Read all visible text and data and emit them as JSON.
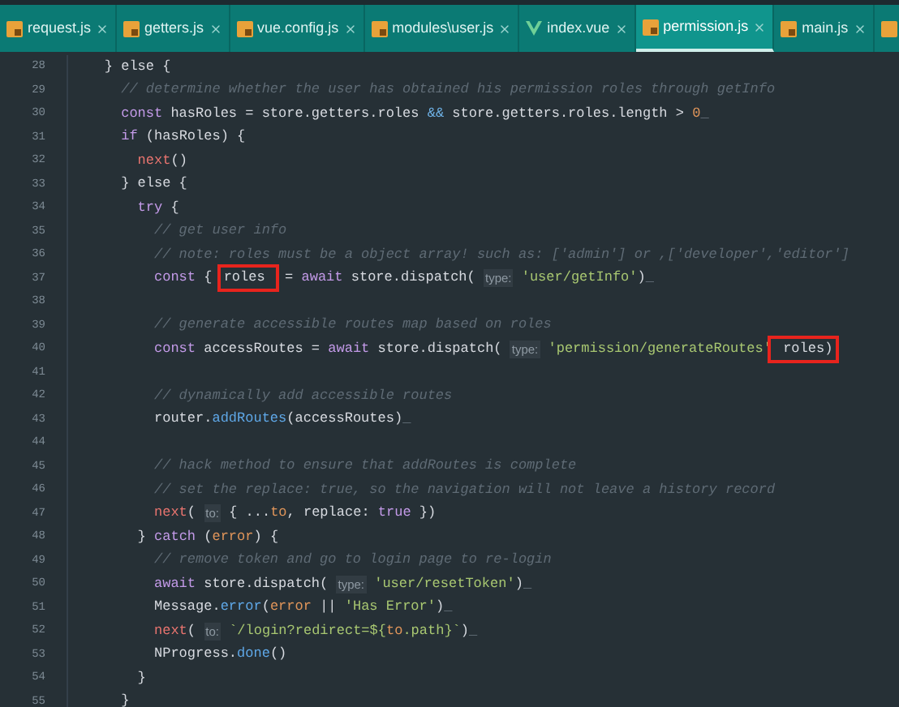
{
  "tabs": [
    {
      "label": "request.js",
      "kind": "js",
      "selected": false
    },
    {
      "label": "getters.js",
      "kind": "js",
      "selected": false
    },
    {
      "label": "vue.config.js",
      "kind": "js",
      "selected": false
    },
    {
      "label": "modules\\user.js",
      "kind": "js",
      "selected": false
    },
    {
      "label": "index.vue",
      "kind": "vue",
      "selected": false
    },
    {
      "label": "permission.js",
      "kind": "js",
      "selected": true
    },
    {
      "label": "main.js",
      "kind": "js",
      "selected": false
    }
  ],
  "lines": [
    {
      "number": "28",
      "tokens": [
        {
          "text": "    } else {",
          "kind": "plain"
        }
      ]
    },
    {
      "number": "29",
      "tokens": [
        {
          "text": "      // determine whether the user has obtained his permission roles through getInfo",
          "kind": "comment"
        }
      ]
    },
    {
      "number": "30",
      "tokens": [
        {
          "text": "      const",
          "kind": "kw"
        },
        {
          "text": " hasRoles = store.getters.roles ",
          "kind": "plain"
        },
        {
          "text": "&&",
          "kind": "op"
        },
        {
          "text": " store.getters.roles.length > ",
          "kind": "plain"
        },
        {
          "text": "0",
          "kind": "num"
        },
        {
          "text": "_",
          "kind": "mark"
        }
      ]
    },
    {
      "number": "31",
      "tokens": [
        {
          "text": "      if",
          "kind": "kw"
        },
        {
          "text": " (hasRoles) {",
          "kind": "plain"
        }
      ]
    },
    {
      "number": "32",
      "tokens": [
        {
          "text": "        next",
          "kind": "call"
        },
        {
          "text": "()",
          "kind": "plain"
        }
      ]
    },
    {
      "number": "33",
      "tokens": [
        {
          "text": "      } else {",
          "kind": "plain"
        }
      ]
    },
    {
      "number": "34",
      "tokens": [
        {
          "text": "        try",
          "kind": "kw"
        },
        {
          "text": " {",
          "kind": "plain"
        }
      ]
    },
    {
      "number": "35",
      "tokens": [
        {
          "text": "          // get user info",
          "kind": "comment"
        }
      ]
    },
    {
      "number": "36",
      "tokens": [
        {
          "text": "          // note: roles must be a object array! such as: ['admin'] or ,['developer','editor']",
          "kind": "comment"
        }
      ]
    },
    {
      "number": "37",
      "tokens": [
        {
          "text": "          const",
          "kind": "kw"
        },
        {
          "text": " { ",
          "kind": "plain"
        },
        {
          "text": "roles ",
          "kind": "boxed"
        },
        {
          "text": " = ",
          "kind": "plain"
        },
        {
          "text": "await",
          "kind": "kw"
        },
        {
          "text": " store.dispatch( ",
          "kind": "plain"
        },
        {
          "text": "type:",
          "kind": "hint"
        },
        {
          "text": " 'user/getInfo'",
          "kind": "str"
        },
        {
          "text": ")",
          "kind": "plain"
        },
        {
          "text": "_",
          "kind": "mark"
        }
      ]
    },
    {
      "number": "38"
    },
    {
      "number": "39",
      "tokens": [
        {
          "text": "          // generate accessible routes map based on roles",
          "kind": "comment"
        }
      ]
    },
    {
      "number": "40",
      "tokens": [
        {
          "text": "          const",
          "kind": "kw"
        },
        {
          "text": " accessRoutes = ",
          "kind": "plain"
        },
        {
          "text": "await",
          "kind": "kw"
        },
        {
          "text": " store.dispatch( ",
          "kind": "plain"
        },
        {
          "text": "type:",
          "kind": "hint"
        },
        {
          "text": " 'permission/generateRoutes'",
          "kind": "str"
        },
        {
          "text": " roles)",
          "kind": "boxed"
        }
      ]
    },
    {
      "number": "41"
    },
    {
      "number": "42",
      "tokens": [
        {
          "text": "          // dynamically add accessible routes",
          "kind": "comment"
        }
      ]
    },
    {
      "number": "43",
      "tokens": [
        {
          "text": "          router.",
          "kind": "plain"
        },
        {
          "text": "addRoutes",
          "kind": "method"
        },
        {
          "text": "(accessRoutes)",
          "kind": "plain"
        },
        {
          "text": "_",
          "kind": "mark"
        }
      ]
    },
    {
      "number": "44"
    },
    {
      "number": "45",
      "tokens": [
        {
          "text": "          // hack method to ensure that addRoutes is complete",
          "kind": "comment"
        }
      ]
    },
    {
      "number": "46",
      "tokens": [
        {
          "text": "          // set the replace: true, so the navigation will not leave a history record",
          "kind": "comment"
        }
      ]
    },
    {
      "number": "47",
      "tokens": [
        {
          "text": "          next",
          "kind": "call"
        },
        {
          "text": "( ",
          "kind": "plain"
        },
        {
          "text": "to:",
          "kind": "hint"
        },
        {
          "text": " { ...",
          "kind": "plain"
        },
        {
          "text": "to",
          "kind": "param"
        },
        {
          "text": ", replace: ",
          "kind": "plain"
        },
        {
          "text": "true",
          "kind": "kw"
        },
        {
          "text": " })",
          "kind": "plain"
        }
      ]
    },
    {
      "number": "48",
      "tokens": [
        {
          "text": "        } ",
          "kind": "plain"
        },
        {
          "text": "catch",
          "kind": "kw"
        },
        {
          "text": " (",
          "kind": "plain"
        },
        {
          "text": "error",
          "kind": "param"
        },
        {
          "text": ") {",
          "kind": "plain"
        }
      ]
    },
    {
      "number": "49",
      "tokens": [
        {
          "text": "          // remove token and go to login page to re-login",
          "kind": "comment"
        }
      ]
    },
    {
      "number": "50",
      "tokens": [
        {
          "text": "          await",
          "kind": "kw"
        },
        {
          "text": " store.dispatch( ",
          "kind": "plain"
        },
        {
          "text": "type:",
          "kind": "hint"
        },
        {
          "text": " 'user/resetToken'",
          "kind": "str"
        },
        {
          "text": ")",
          "kind": "plain"
        },
        {
          "text": "_",
          "kind": "mark"
        }
      ]
    },
    {
      "number": "51",
      "tokens": [
        {
          "text": "          Message.",
          "kind": "plain"
        },
        {
          "text": "error",
          "kind": "method"
        },
        {
          "text": "(",
          "kind": "plain"
        },
        {
          "text": "error",
          "kind": "param"
        },
        {
          "text": " || ",
          "kind": "plain"
        },
        {
          "text": "'Has Error'",
          "kind": "str"
        },
        {
          "text": ")",
          "kind": "plain"
        },
        {
          "text": "_",
          "kind": "mark"
        }
      ]
    },
    {
      "number": "52",
      "tokens": [
        {
          "text": "          next",
          "kind": "call"
        },
        {
          "text": "( ",
          "kind": "plain"
        },
        {
          "text": "to:",
          "kind": "hint"
        },
        {
          "text": " `/login?redirect=${",
          "kind": "str"
        },
        {
          "text": "to",
          "kind": "param"
        },
        {
          "text": ".path}`",
          "kind": "str"
        },
        {
          "text": ")",
          "kind": "plain"
        },
        {
          "text": "_",
          "kind": "mark"
        }
      ]
    },
    {
      "number": "53",
      "tokens": [
        {
          "text": "          NProgress.",
          "kind": "plain"
        },
        {
          "text": "done",
          "kind": "method"
        },
        {
          "text": "()",
          "kind": "plain"
        }
      ]
    },
    {
      "number": "54",
      "tokens": [
        {
          "text": "        }",
          "kind": "plain"
        }
      ]
    },
    {
      "number": "55",
      "tokens": [
        {
          "text": "      }",
          "kind": "plain"
        }
      ]
    }
  ]
}
